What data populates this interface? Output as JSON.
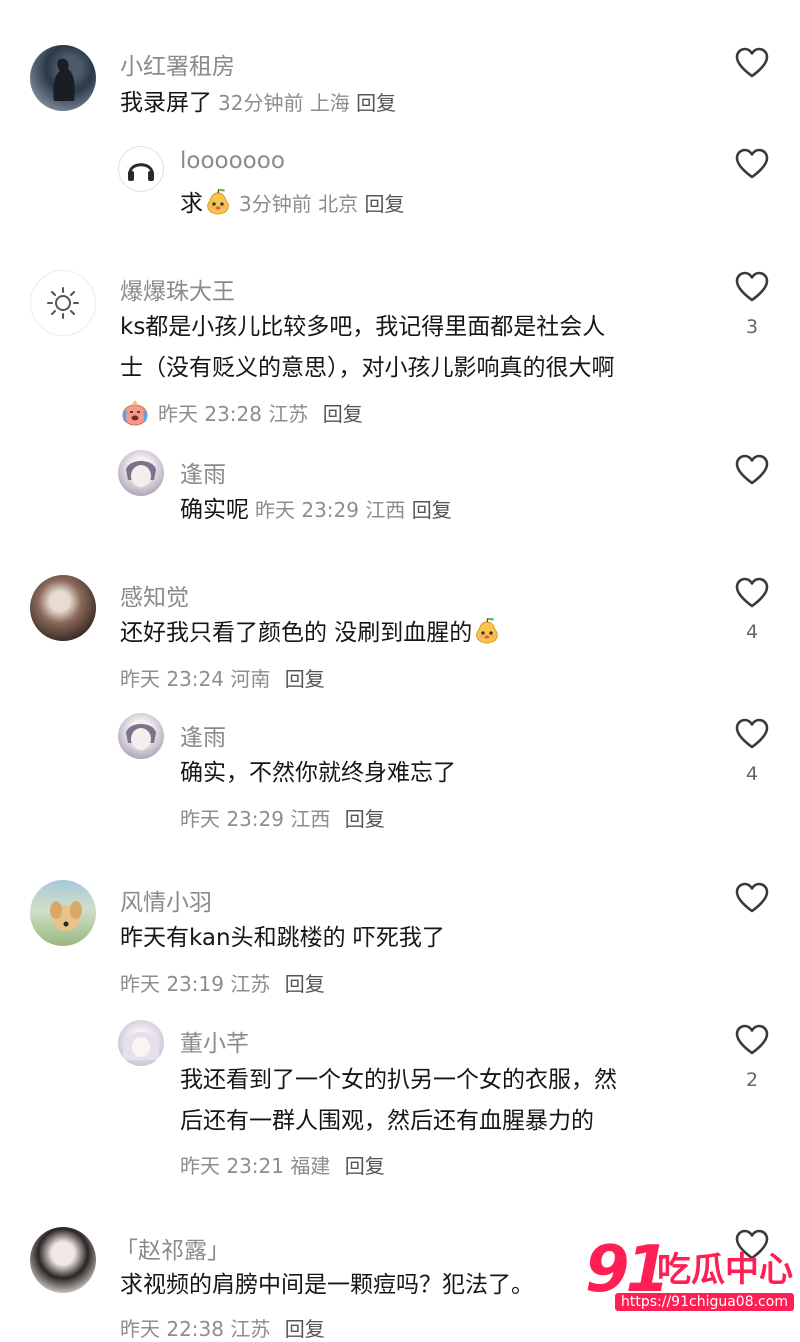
{
  "comments": [
    {
      "username": "小红署租房",
      "text": "我录屏了",
      "time": "32分钟前",
      "location": "上海",
      "reply": "回复",
      "replies": [
        {
          "username": "looooooo",
          "text": "求",
          "time": "3分钟前",
          "location": "北京",
          "reply": "回复"
        }
      ]
    },
    {
      "username": "爆爆珠大王",
      "text_line1": "ks都是小孩儿比较多吧，我记得里面都是社会人",
      "text_line2": "士（没有贬义的意思），对小孩儿影响真的很大啊",
      "time": "昨天 23:28",
      "location": "江苏",
      "reply": "回复",
      "likes": "3",
      "replies": [
        {
          "username": "逢雨",
          "text": "确实呢",
          "time": "昨天 23:29",
          "location": "江西",
          "reply": "回复"
        }
      ]
    },
    {
      "username": "感知觉",
      "text": "还好我只看了颜色的 没刷到血腥的",
      "time": "昨天 23:24",
      "location": "河南",
      "reply": "回复",
      "likes": "4",
      "replies": [
        {
          "username": "逢雨",
          "text": "确实，不然你就终身难忘了",
          "time": "昨天 23:29",
          "location": "江西",
          "reply": "回复",
          "likes": "4"
        }
      ]
    },
    {
      "username": "风情小羽",
      "text": "昨天有kan头和跳楼的 吓死我了",
      "time": "昨天 23:19",
      "location": "江苏",
      "reply": "回复",
      "replies": [
        {
          "username": "董小芊",
          "text_line1": "我还看到了一个女的扒另一个女的衣服，然",
          "text_line2": "后还有一群人围观，然后还有血腥暴力的",
          "time": "昨天 23:21",
          "location": "福建",
          "reply": "回复",
          "likes": "2"
        }
      ]
    },
    {
      "username": "「赵祁露」",
      "text": "求视频的肩膀中间是一颗痘吗？犯法了。",
      "time": "昨天 22:38",
      "location": "江苏",
      "reply": "回复"
    }
  ],
  "watermark": {
    "logo": "91",
    "name": "吃瓜中心",
    "url": "https://91chigua08.com"
  },
  "colors": {
    "username": "#8a8a8a",
    "meta": "#8d8d8d",
    "watermark": "#ff1f54"
  },
  "icons": {
    "like": "heart-outline-icon",
    "emoji_pear": "pear-emoji-icon",
    "emoji_crying": "crying-face-emoji-icon"
  }
}
